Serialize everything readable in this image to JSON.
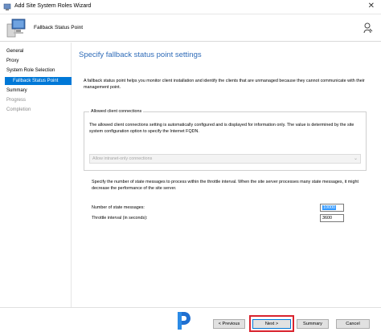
{
  "window": {
    "title": "Add Site System Roles Wizard",
    "close_glyph": "✕"
  },
  "header": {
    "page_name": "Fallback Status Point"
  },
  "sidebar": {
    "items": [
      {
        "label": "General",
        "state": "normal"
      },
      {
        "label": "Proxy",
        "state": "normal"
      },
      {
        "label": "System Role Selection",
        "state": "normal"
      },
      {
        "label": "Fallback Status Point",
        "state": "active"
      },
      {
        "label": "Summary",
        "state": "normal"
      },
      {
        "label": "Progress",
        "state": "muted"
      },
      {
        "label": "Completion",
        "state": "muted"
      }
    ]
  },
  "main": {
    "heading": "Specify fallback status point settings",
    "intro": "A fallback status point helps you monitor client installation and identify the clients that are unmanaged because they cannot communicate with their management point.",
    "allowed": {
      "legend": "Allowed client connections",
      "text": "The allowed client connections setting is automatically configured and is displayed for information only. The value is determined by the site system configuration option to specify the Internet FQDN.",
      "combo_value": "Allow intranet-only connections"
    },
    "throttle_text": "Specify the number of state messages to process within the throttle interval. When the site server processes many state messages, it might decrease the performance of the site server.",
    "fields": {
      "state_messages_label": "Number of state messages:",
      "state_messages_value": "10000",
      "throttle_label": "Throttle interval (in seconds):",
      "throttle_value": "3600"
    }
  },
  "footer": {
    "previous": "< Previous",
    "next": "Next >",
    "summary": "Summary",
    "cancel": "Cancel"
  },
  "colors": {
    "accent": "#0078d7",
    "heading": "#2e6bb8",
    "highlight": "#d9232e"
  }
}
